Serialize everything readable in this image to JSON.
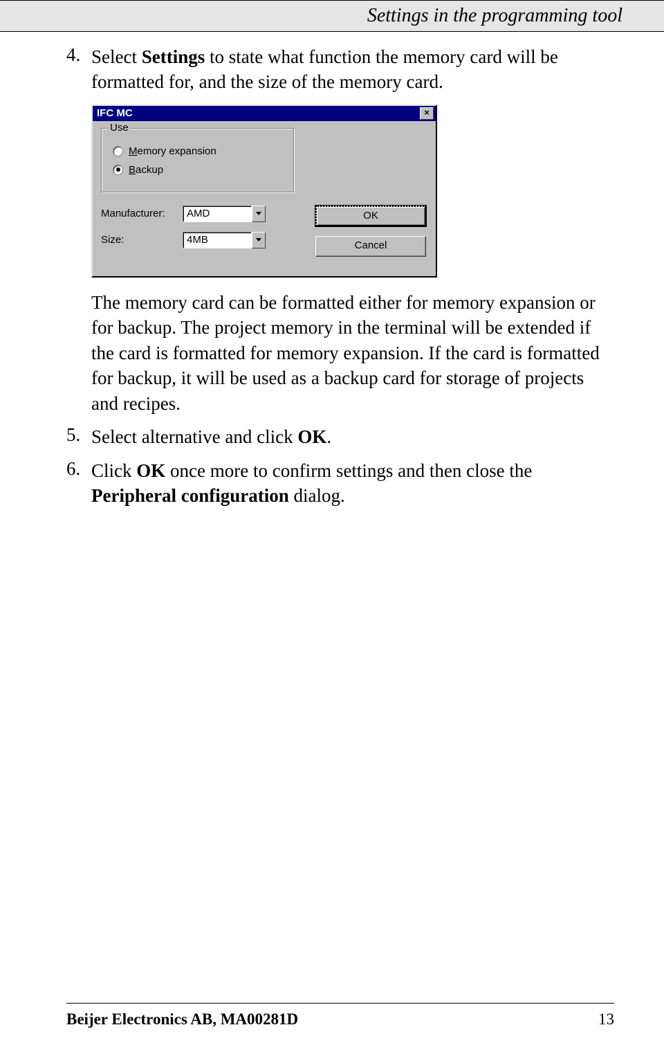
{
  "header": {
    "title": "Settings in the programming tool"
  },
  "steps": {
    "s4": {
      "num": "4.",
      "pre": "Select ",
      "bold": "Settings",
      "post": " to state what function the memory card will be formatted for, and the size of the memory card."
    },
    "s4b": {
      "text": "The memory card can be formatted either for memory expansion or for backup. The project memory in the terminal will be extended if the card is formatted for memory expansion. If the card is formatted for backup, it will be used as a backup card for storage of projects and recipes."
    },
    "s5": {
      "num": "5.",
      "pre": "Select alternative and click ",
      "bold": "OK",
      "post": "."
    },
    "s6": {
      "num": "6.",
      "pre": "Click ",
      "bold1": "OK",
      "mid": " once more to confirm settings and then close the ",
      "bold2": "Peripheral configuration",
      "post": " dialog."
    }
  },
  "dialog": {
    "title": "IFC MC",
    "close": "×",
    "group_legend": "Use",
    "radio1": "Memory expansion",
    "radio2": "Backup",
    "manufacturer_label": "Manufacturer:",
    "manufacturer_value": "AMD",
    "size_label": "Size:",
    "size_value": "4MB",
    "ok": "OK",
    "cancel": "Cancel"
  },
  "footer": {
    "left": "Beijer Electronics AB, MA00281D",
    "right": "13"
  }
}
